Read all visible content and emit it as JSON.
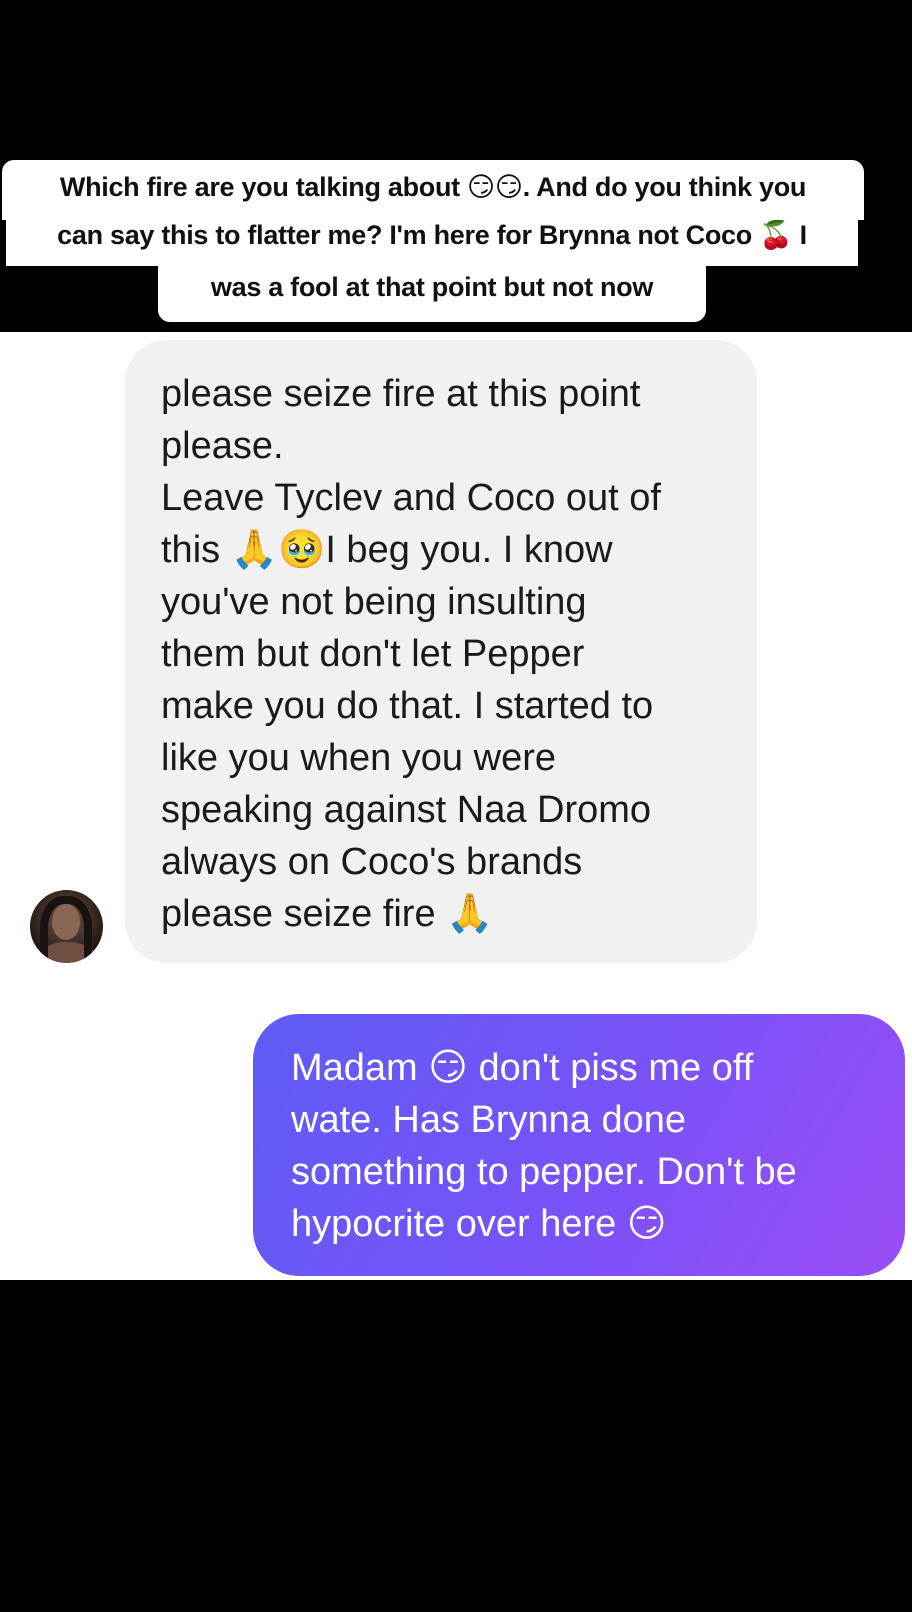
{
  "caption": {
    "line1": "Which fire are you talking about 😏😏. And do you think you",
    "line2": "can say this to flatter me? I'm here for Brynna not Coco 🍒 I",
    "line3": "was a fool at that point but not now"
  },
  "messages": {
    "incoming": {
      "text": "please seize fire at this point\nplease.\nLeave Tyclev and Coco out of\nthis 🙏🥹I beg you. I know\nyou've not being insulting\nthem but don't let Pepper\nmake you do that. I started to\nlike you when you were\nspeaking against Naa Dromo\nalways on Coco's brands\nplease seize fire 🙏"
    },
    "outgoing": {
      "text": "Madam 😏 don't piss me off\nwate. Has Brynna done\nsomething to pepper. Don't be\nhypocrite over here 😏"
    }
  },
  "colors": {
    "incoming_bubble": "#f1f1f1",
    "outgoing_gradient_start": "#5e5cf6",
    "outgoing_gradient_end": "#9b4df6",
    "background_bars": "#000000",
    "chat_background": "#ffffff"
  },
  "icons": {
    "avatar": "profile-photo"
  }
}
